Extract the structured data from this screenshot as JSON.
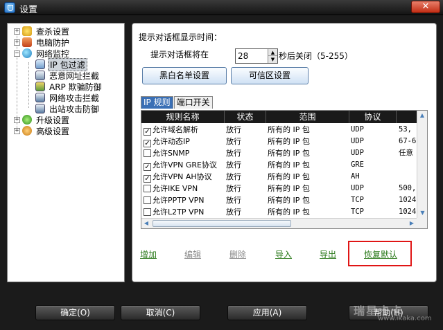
{
  "window": {
    "title": "设置",
    "close_label": "✕"
  },
  "tree": {
    "items": [
      {
        "label": "查杀设置",
        "expander": "+"
      },
      {
        "label": "电脑防护",
        "expander": "+"
      },
      {
        "label": "网络监控",
        "expander": "−"
      },
      {
        "label": "IP 包过滤"
      },
      {
        "label": "恶意网址拦截"
      },
      {
        "label": "ARP 欺骗防御"
      },
      {
        "label": "网络攻击拦截"
      },
      {
        "label": "出站攻击防御"
      },
      {
        "label": "升级设置",
        "expander": "+"
      },
      {
        "label": "高级设置",
        "expander": "+"
      }
    ]
  },
  "panel": {
    "prompt_time_label": "提示对话框显示时间：",
    "prompt_will_label": "提示对话框将在",
    "spin_value": "28",
    "spin_suffix": "秒后关闭（5-255）",
    "blacklist_button": "黑白名单设置",
    "trusted_button": "可信区设置",
    "tabs": [
      "IP 规则",
      "端口开关"
    ],
    "columns": [
      "规则名称",
      "状态",
      "范围",
      "协议"
    ],
    "rows": [
      {
        "checked": true,
        "name": "允许域名解析",
        "status": "放行",
        "scope": "所有的 IP 包",
        "protocol": "UDP",
        "extra": "53,"
      },
      {
        "checked": true,
        "name": "允许动态IP",
        "status": "放行",
        "scope": "所有的 IP 包",
        "protocol": "UDP",
        "extra": "67-6"
      },
      {
        "checked": false,
        "name": "允许SNMP",
        "status": "放行",
        "scope": "所有的 IP 包",
        "protocol": "UDP",
        "extra": "任意"
      },
      {
        "checked": true,
        "name": "允许VPN GRE协议",
        "status": "放行",
        "scope": "所有的 IP 包",
        "protocol": "GRE",
        "extra": ""
      },
      {
        "checked": true,
        "name": "允许VPN AH协议",
        "status": "放行",
        "scope": "所有的 IP 包",
        "protocol": "AH",
        "extra": ""
      },
      {
        "checked": false,
        "name": "允许IKE VPN",
        "status": "放行",
        "scope": "所有的 IP 包",
        "protocol": "UDP",
        "extra": "500,"
      },
      {
        "checked": false,
        "name": "允许PPTP VPN",
        "status": "放行",
        "scope": "所有的 IP 包",
        "protocol": "TCP",
        "extra": "1024"
      },
      {
        "checked": false,
        "name": "允许L2TP VPN",
        "status": "放行",
        "scope": "所有的 IP 包",
        "protocol": "TCP",
        "extra": "1024"
      }
    ],
    "actions": {
      "add": "增加",
      "edit": "编辑",
      "delete": "删除",
      "import": "导入",
      "export": "导出",
      "restore": "恢复默认"
    }
  },
  "footer": {
    "ok": "确定(O)",
    "cancel": "取消(C)",
    "apply": "应用(A)",
    "help": "帮助(H)"
  },
  "watermark": {
    "line1": "瑞星卡卡",
    "line2": "www.ikaka.com"
  },
  "colors": {
    "selection": "#cfd5dc",
    "link_green": "#2b7a1b",
    "highlight_red": "#e01515",
    "tab_active": "#3a6fb5"
  }
}
